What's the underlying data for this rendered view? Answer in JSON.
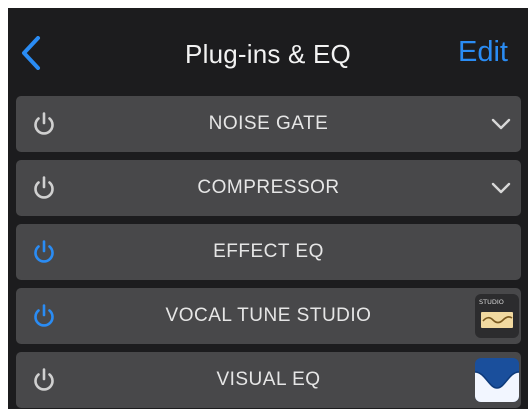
{
  "header": {
    "title": "Plug-ins & EQ",
    "edit_label": "Edit",
    "back_icon": "chevron-left-icon"
  },
  "plugins": [
    {
      "label": "NOISE GATE",
      "enabled": false,
      "accessory": "chevron-down-icon"
    },
    {
      "label": "COMPRESSOR",
      "enabled": false,
      "accessory": "chevron-down-icon"
    },
    {
      "label": "EFFECT EQ",
      "enabled": true,
      "accessory": ""
    },
    {
      "label": "VOCAL TUNE STUDIO",
      "enabled": true,
      "accessory": "vocal-tune-studio-thumbnail",
      "thumbnail_text": "STUDIO"
    },
    {
      "label": "VISUAL EQ",
      "enabled": false,
      "accessory": "visual-eq-thumbnail"
    }
  ],
  "colors": {
    "background": "#1c1c1e",
    "row": "#48484a",
    "accent": "#2a8cf4",
    "power_off": "#d0d0d0",
    "text": "#e6e6e6"
  }
}
